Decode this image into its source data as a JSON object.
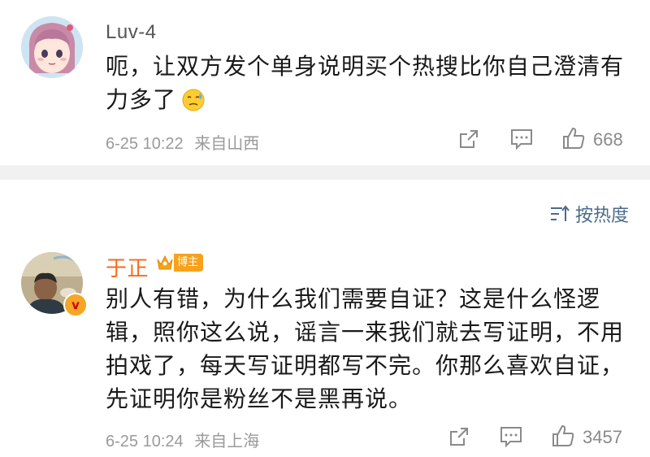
{
  "comments": [
    {
      "username": "Luv-4",
      "text_line1": "呃，让双方发个单身说明买个热搜比你自己澄清有",
      "text_line2": "力多了",
      "emoji": "cold-sweat-emoji",
      "time": "6-25 10:22",
      "location": "来自山西",
      "likes": "668"
    },
    {
      "username": "于正",
      "badge": "博主",
      "text_lines": [
        "别人有错，为什么我们需要自证？这是什么怪逻",
        "辑，照你这么说，谣言一来我们就去写证明，不用",
        "拍戏了，每天写证明都写不完。你那么喜欢自证，",
        "先证明你是粉丝不是黑再说。"
      ],
      "verified_mark": "v",
      "time": "6-25 10:24",
      "location": "来自上海",
      "likes": "3457"
    }
  ],
  "sort": {
    "label": "按热度",
    "icon": "sort-icon"
  },
  "icons": {
    "share": "share-icon",
    "comment": "comment-icon",
    "like": "thumbs-up-icon"
  },
  "colors": {
    "vip_name": "#f26b1d",
    "badge_bg": "#f7a21b",
    "sort_text": "#4a6b8a",
    "meta_text": "#9a9a9a"
  }
}
